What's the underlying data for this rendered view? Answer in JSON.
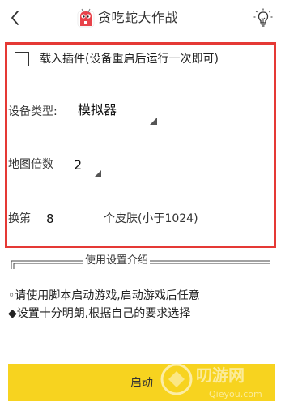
{
  "header": {
    "title": "贪吃蛇大作战",
    "back_icon": "chevron-left-icon",
    "app_icon": "snake-app-icon",
    "help_icon": "lightbulb-icon"
  },
  "settings": {
    "load_plugin_label": "载入插件(设备重启后运行一次即可)",
    "load_plugin_checked": false,
    "device_type_label": "设备类型:",
    "device_type_value": "模拟器",
    "map_scale_label": "地图倍数",
    "map_scale_value": "2",
    "skin_prefix": "换第",
    "skin_value": "8",
    "skin_suffix": "个皮肤(小于1024)"
  },
  "intro": {
    "title": "使用设置介绍",
    "line1": "◦请使用脚本启动游戏,启动游戏后任意",
    "line2": "◆设置十分明朗,根据自己的要求选择"
  },
  "footer": {
    "start_label": "启动"
  },
  "watermark": {
    "text_cn": "叨游网",
    "text_en": "Qieyou.com"
  },
  "colors": {
    "highlight_border": "#e53935",
    "start_button": "#f7d31f"
  }
}
